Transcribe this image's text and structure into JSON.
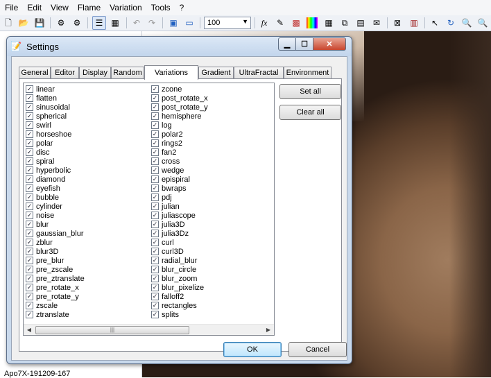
{
  "menu": [
    "File",
    "Edit",
    "View",
    "Flame",
    "Variation",
    "Tools",
    "?"
  ],
  "toolbar": {
    "zoom_value": "100",
    "icons": [
      "new-icon",
      "open-icon",
      "save-icon",
      "render-icon",
      "render-all-icon",
      "list-view-icon",
      "icon-view-icon",
      "undo-icon",
      "redo-icon",
      "fullscreen-icon",
      "preview-icon",
      "zoom-combo",
      "formula-icon",
      "editor-icon",
      "palette-icon",
      "gradient-icon",
      "mutate-icon",
      "adjust-icon",
      "options-icon",
      "script-icon",
      "transparency-icon",
      "film-icon",
      "select-icon",
      "rotate-icon",
      "zoom-in-icon",
      "zoom-out-icon"
    ]
  },
  "left_panel": {
    "status_text": "Apo7X-191209-167"
  },
  "dialog": {
    "title": "Settings",
    "tabs": [
      "General",
      "Editor",
      "Display",
      "Random",
      "Variations",
      "Gradient",
      "UltraFractal",
      "Environment"
    ],
    "active_tab": "Variations",
    "variations_left": [
      "linear",
      "flatten",
      "sinusoidal",
      "spherical",
      "swirl",
      "horseshoe",
      "polar",
      "disc",
      "spiral",
      "hyperbolic",
      "diamond",
      "eyefish",
      "bubble",
      "cylinder",
      "noise",
      "blur",
      "gaussian_blur",
      "zblur",
      "blur3D",
      "pre_blur",
      "pre_zscale",
      "pre_ztranslate",
      "pre_rotate_x",
      "pre_rotate_y",
      "zscale",
      "ztranslate"
    ],
    "variations_right": [
      "zcone",
      "post_rotate_x",
      "post_rotate_y",
      "hemisphere",
      "log",
      "polar2",
      "rings2",
      "fan2",
      "cross",
      "wedge",
      "epispiral",
      "bwraps",
      "pdj",
      "julian",
      "juliascope",
      "julia3D",
      "julia3Dz",
      "curl",
      "curl3D",
      "radial_blur",
      "blur_circle",
      "blur_zoom",
      "blur_pixelize",
      "falloff2",
      "rectangles",
      "splits"
    ],
    "set_all_label": "Set all",
    "clear_all_label": "Clear all",
    "ok_label": "OK",
    "cancel_label": "Cancel"
  }
}
